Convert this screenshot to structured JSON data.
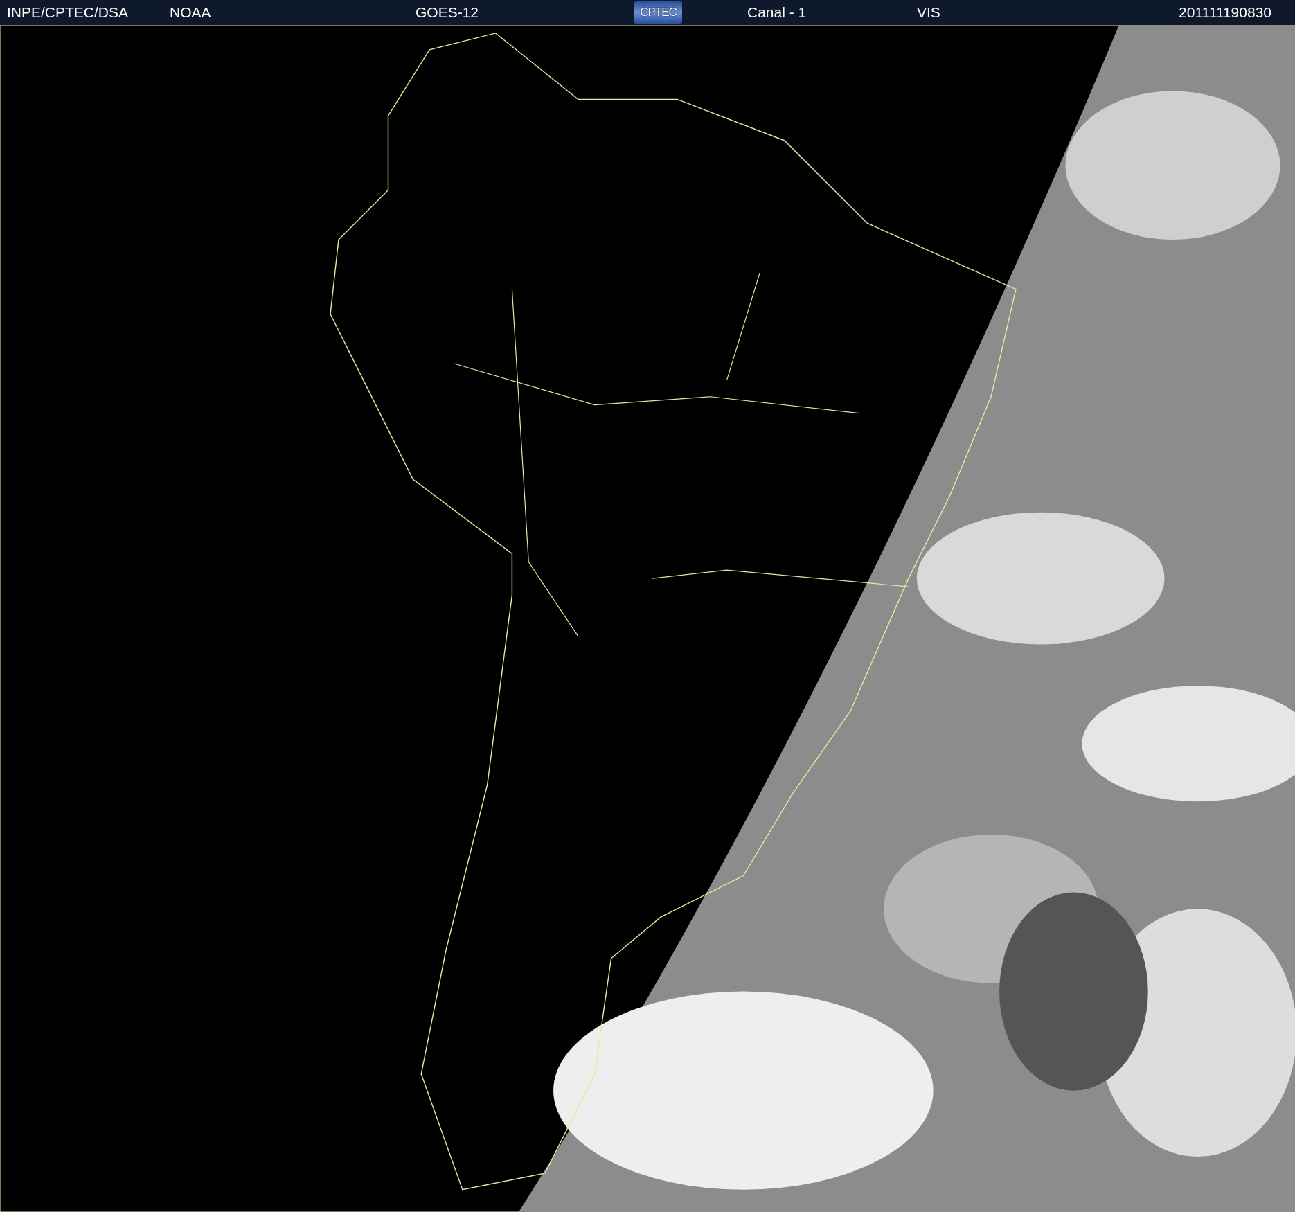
{
  "header": {
    "source": "INPE/CPTEC/DSA",
    "agency": "NOAA",
    "satellite": "GOES-12",
    "logo": "CPTEC",
    "channel": "Canal - 1",
    "band": "VIS",
    "timestamp": "201111190830"
  }
}
